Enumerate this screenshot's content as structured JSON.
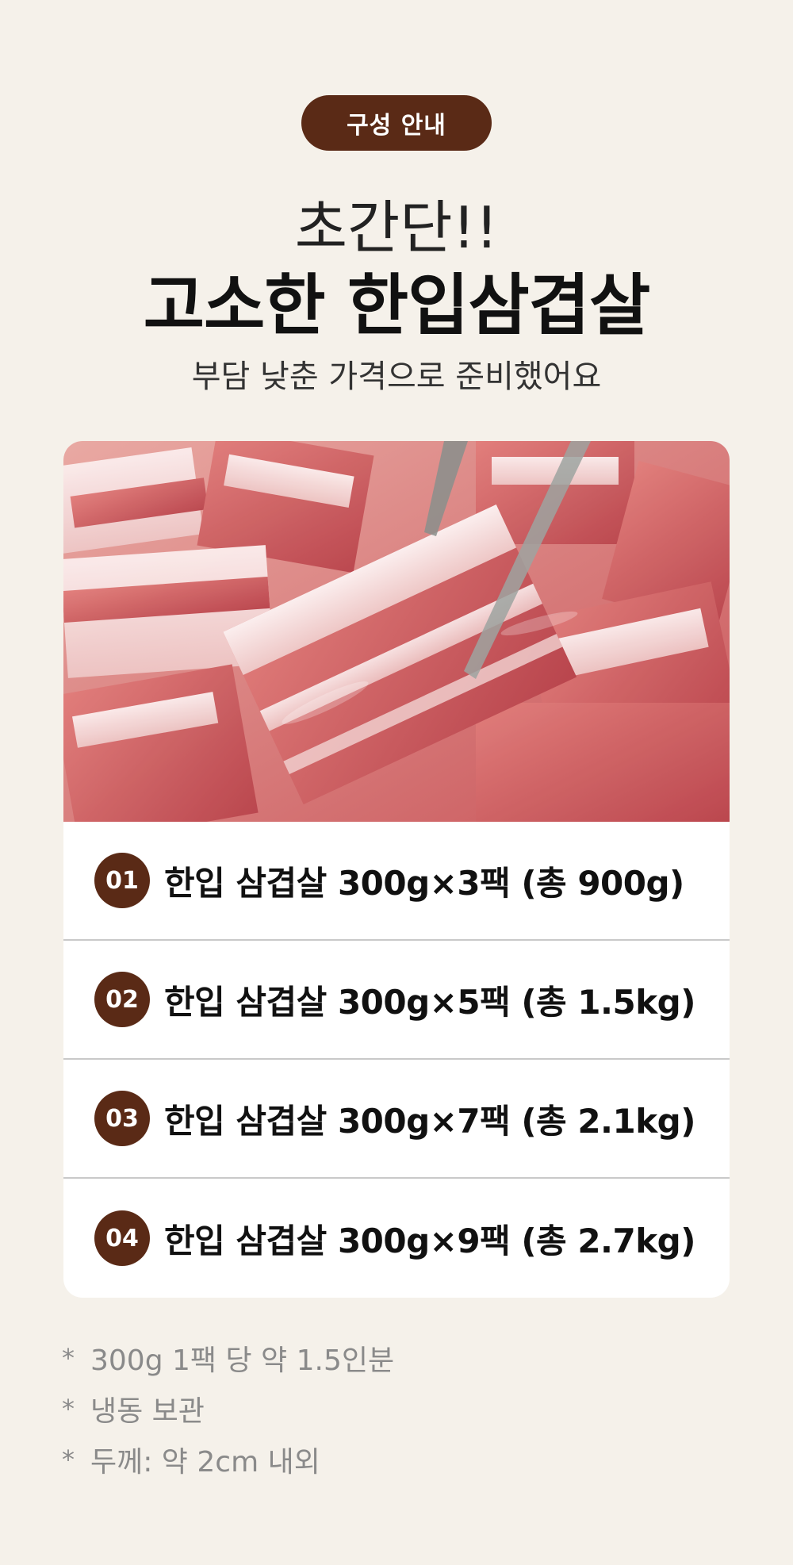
{
  "badge": {
    "label": "구성 안내"
  },
  "headline": {
    "line1": "초간단!!",
    "line2": "고소한 한입삼겹살"
  },
  "subtitle": "부담 낮춘 가격으로 준비했어요",
  "product_image": {
    "icon": "pork-belly-photo"
  },
  "options": [
    {
      "number": "01",
      "label": "한입 삼겹살 300g×3팩 (총 900g)"
    },
    {
      "number": "02",
      "label": "한입 삼겹살 300g×5팩 (총 1.5kg)"
    },
    {
      "number": "03",
      "label": "한입 삼겹살 300g×7팩 (총 2.1kg)"
    },
    {
      "number": "04",
      "label": "한입 삼겹살 300g×9팩 (총 2.7kg)"
    }
  ],
  "notes": [
    {
      "bullet": "*",
      "text": "300g 1팩 당 약 1.5인분"
    },
    {
      "bullet": "*",
      "text": "냉동 보관"
    },
    {
      "bullet": "*",
      "text": "두께: 약 2cm 내외"
    }
  ],
  "colors": {
    "background": "#f5f1ea",
    "accent": "#5a2a16",
    "card": "#ffffff",
    "note_text": "#8a8a8a"
  }
}
